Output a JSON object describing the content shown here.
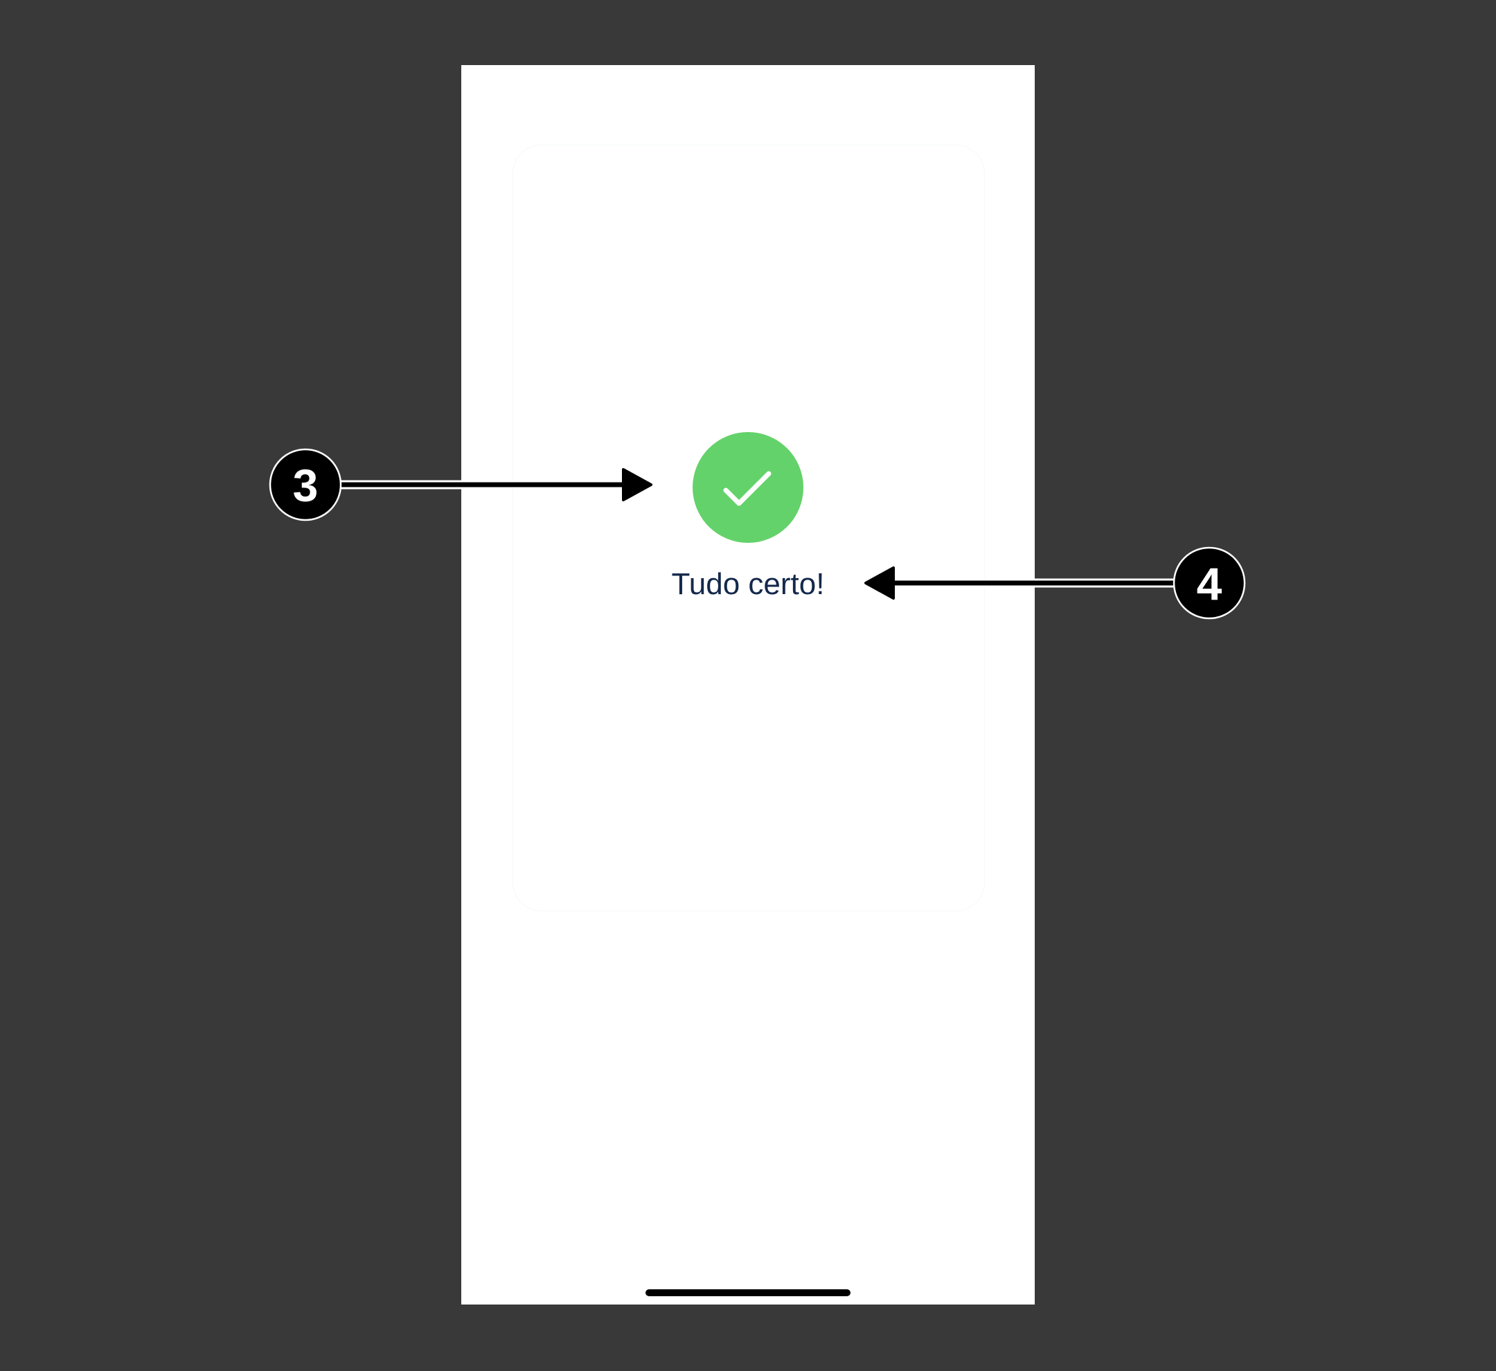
{
  "screen": {
    "status_message": "Tudo certo!",
    "status_icon": "check-icon"
  },
  "annotations": [
    {
      "number": "3",
      "target": "success-icon"
    },
    {
      "number": "4",
      "target": "success-message"
    }
  ],
  "colors": {
    "backdrop": "#3a3939",
    "success": "#63d26a",
    "text": "#14284b"
  }
}
